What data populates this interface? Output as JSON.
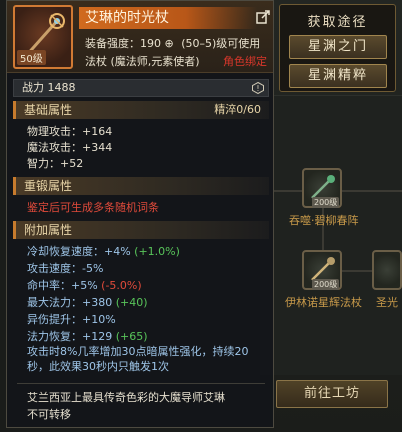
{
  "acquire": {
    "title": "获取途径",
    "buttons": [
      "星渊之门",
      "星渊精粹"
    ]
  },
  "background": {
    "nodes": [
      {
        "level": "200级",
        "name": "吞噬·碧柳春阵"
      },
      {
        "level": "200级",
        "name": "伊林诺星辉法杖"
      },
      {
        "level": "",
        "name": "圣光"
      }
    ],
    "goto_button": "前往工坊"
  },
  "item": {
    "name": "艾琳的时光杖",
    "level_badge": "50级",
    "equip_strength": "装备强度：190",
    "level_requirement": "(50–5)级可使用",
    "weapon_type": "法杖 (魔法师,元素使者)",
    "bound": "角色绑定",
    "power": "战力 1488"
  },
  "basic": {
    "title": "基础属性",
    "refine": "精淬0/60",
    "stats": [
      "物理攻击：+164",
      "魔法攻击：+344",
      "智力：+52"
    ]
  },
  "reforge": {
    "title": "重锻属性",
    "note": "鉴定后可生成多条随机词条"
  },
  "extra": {
    "title": "附加属性",
    "stats": [
      {
        "base": "冷却恢复速度：+4%",
        "bonus": "(+1.0%)",
        "bonus_color": "green"
      },
      {
        "base": "攻击速度：-5%",
        "bonus": "",
        "bonus_color": ""
      },
      {
        "base": "命中率：+5%",
        "bonus": "(-5.0%)",
        "bonus_color": "red"
      },
      {
        "base": "最大法力：+380",
        "bonus": "(+40)",
        "bonus_color": "green"
      },
      {
        "base": "异伤提升：+10%",
        "bonus": "",
        "bonus_color": ""
      },
      {
        "base": "法力恢复：+129",
        "bonus": "(+65)",
        "bonus_color": "green"
      }
    ],
    "effect": "攻击时8%几率增加30点暗属性强化，持续20秒，此效果30秒内只触发1次"
  },
  "lore": "艾兰西亚上最具传奇色彩的大魔导师艾琳",
  "transfer": "不可转移",
  "colors": {
    "accent_orange": "#d06a1e",
    "stat_blue": "#9ec5e8",
    "bonus_green": "#58c45a",
    "warn_red": "#e04a3a"
  }
}
